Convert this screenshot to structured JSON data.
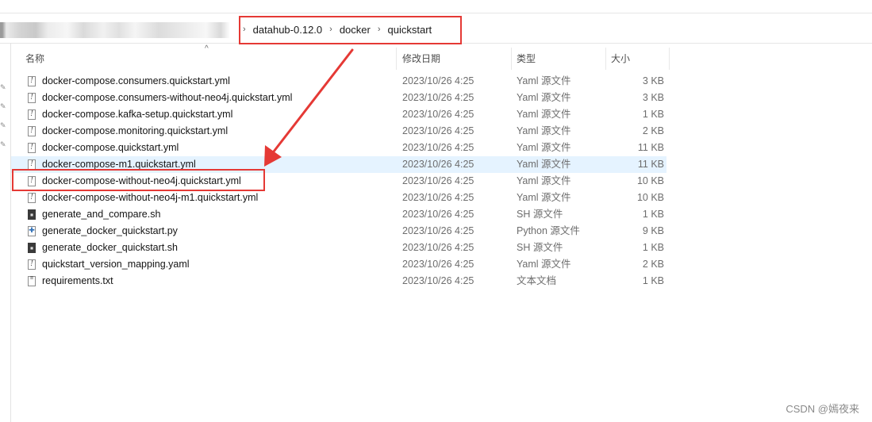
{
  "breadcrumb": {
    "items": [
      "datahub-0.12.0",
      "docker",
      "quickstart"
    ],
    "separator": "›"
  },
  "columns": {
    "name": "名称",
    "date": "修改日期",
    "type": "类型",
    "size": "大小"
  },
  "files": [
    {
      "name": "docker-compose.consumers.quickstart.yml",
      "date": "2023/10/26 4:25",
      "type": "Yaml 源文件",
      "size": "3 KB",
      "icon": "yaml-file-icon"
    },
    {
      "name": "docker-compose.consumers-without-neo4j.quickstart.yml",
      "date": "2023/10/26 4:25",
      "type": "Yaml 源文件",
      "size": "3 KB",
      "icon": "yaml-file-icon"
    },
    {
      "name": "docker-compose.kafka-setup.quickstart.yml",
      "date": "2023/10/26 4:25",
      "type": "Yaml 源文件",
      "size": "1 KB",
      "icon": "yaml-file-icon"
    },
    {
      "name": "docker-compose.monitoring.quickstart.yml",
      "date": "2023/10/26 4:25",
      "type": "Yaml 源文件",
      "size": "2 KB",
      "icon": "yaml-file-icon"
    },
    {
      "name": "docker-compose.quickstart.yml",
      "date": "2023/10/26 4:25",
      "type": "Yaml 源文件",
      "size": "11 KB",
      "icon": "yaml-file-icon"
    },
    {
      "name": "docker-compose-m1.quickstart.yml",
      "date": "2023/10/26 4:25",
      "type": "Yaml 源文件",
      "size": "11 KB",
      "icon": "yaml-file-icon"
    },
    {
      "name": "docker-compose-without-neo4j.quickstart.yml",
      "date": "2023/10/26 4:25",
      "type": "Yaml 源文件",
      "size": "10 KB",
      "icon": "yaml-file-icon"
    },
    {
      "name": "docker-compose-without-neo4j-m1.quickstart.yml",
      "date": "2023/10/26 4:25",
      "type": "Yaml 源文件",
      "size": "10 KB",
      "icon": "yaml-file-icon"
    },
    {
      "name": "generate_and_compare.sh",
      "date": "2023/10/26 4:25",
      "type": "SH 源文件",
      "size": "1 KB",
      "icon": "shell-file-icon"
    },
    {
      "name": "generate_docker_quickstart.py",
      "date": "2023/10/26 4:25",
      "type": "Python 源文件",
      "size": "9 KB",
      "icon": "python-file-icon"
    },
    {
      "name": "generate_docker_quickstart.sh",
      "date": "2023/10/26 4:25",
      "type": "SH 源文件",
      "size": "1 KB",
      "icon": "shell-file-icon"
    },
    {
      "name": "quickstart_version_mapping.yaml",
      "date": "2023/10/26 4:25",
      "type": "Yaml 源文件",
      "size": "2 KB",
      "icon": "yaml-file-icon"
    },
    {
      "name": "requirements.txt",
      "date": "2023/10/26 4:25",
      "type": "文本文档",
      "size": "1 KB",
      "icon": "text-file-icon"
    }
  ],
  "hover_row_index": 5,
  "highlighted_file_index": 6,
  "annotation_color": "#e53935",
  "hover_color": "#e5f3ff",
  "watermark": "CSDN @嫣夜来"
}
